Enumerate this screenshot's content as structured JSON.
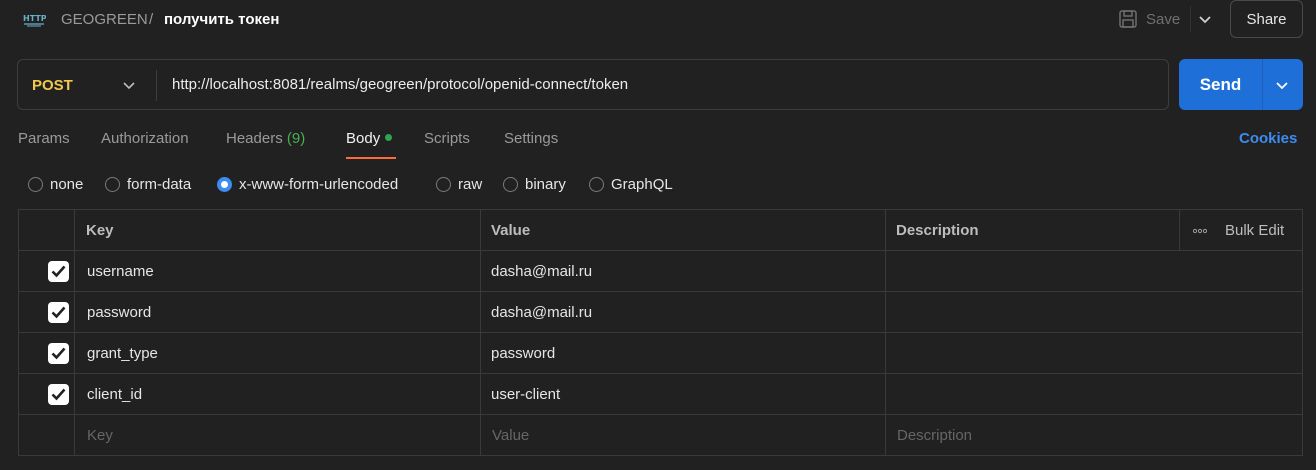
{
  "header": {
    "workspace": "GEOGREEN",
    "separator": "/",
    "request_name": "получить токен",
    "save_label": "Save",
    "share_label": "Share"
  },
  "request": {
    "method": "POST",
    "url": "http://localhost:8081/realms/geogreen/protocol/openid-connect/token",
    "send_label": "Send"
  },
  "tabs": {
    "params": "Params",
    "authorization": "Authorization",
    "headers": "Headers",
    "headers_count": "(9)",
    "body": "Body",
    "scripts": "Scripts",
    "settings": "Settings",
    "cookies": "Cookies",
    "active": "Body"
  },
  "body_types": {
    "none": "none",
    "form_data": "form-data",
    "urlencoded": "x-www-form-urlencoded",
    "raw": "raw",
    "binary": "binary",
    "graphql": "GraphQL",
    "selected": "x-www-form-urlencoded"
  },
  "table": {
    "headers": {
      "key": "Key",
      "value": "Value",
      "description": "Description",
      "bulk_edit": "Bulk Edit"
    },
    "rows": [
      {
        "checked": true,
        "key": "username",
        "value": "dasha@mail.ru",
        "description": ""
      },
      {
        "checked": true,
        "key": "password",
        "value": "dasha@mail.ru",
        "description": ""
      },
      {
        "checked": true,
        "key": "grant_type",
        "value": "password",
        "description": ""
      },
      {
        "checked": true,
        "key": "client_id",
        "value": "user-client",
        "description": ""
      }
    ],
    "placeholders": {
      "key": "Key",
      "value": "Value",
      "description": "Description"
    }
  },
  "colors": {
    "method": "#f2c94c",
    "send": "#1f6fd8",
    "active_tab_underline": "#ff6c37",
    "cookies_link": "#3d8cf0",
    "body_dot": "#2ea44f"
  }
}
